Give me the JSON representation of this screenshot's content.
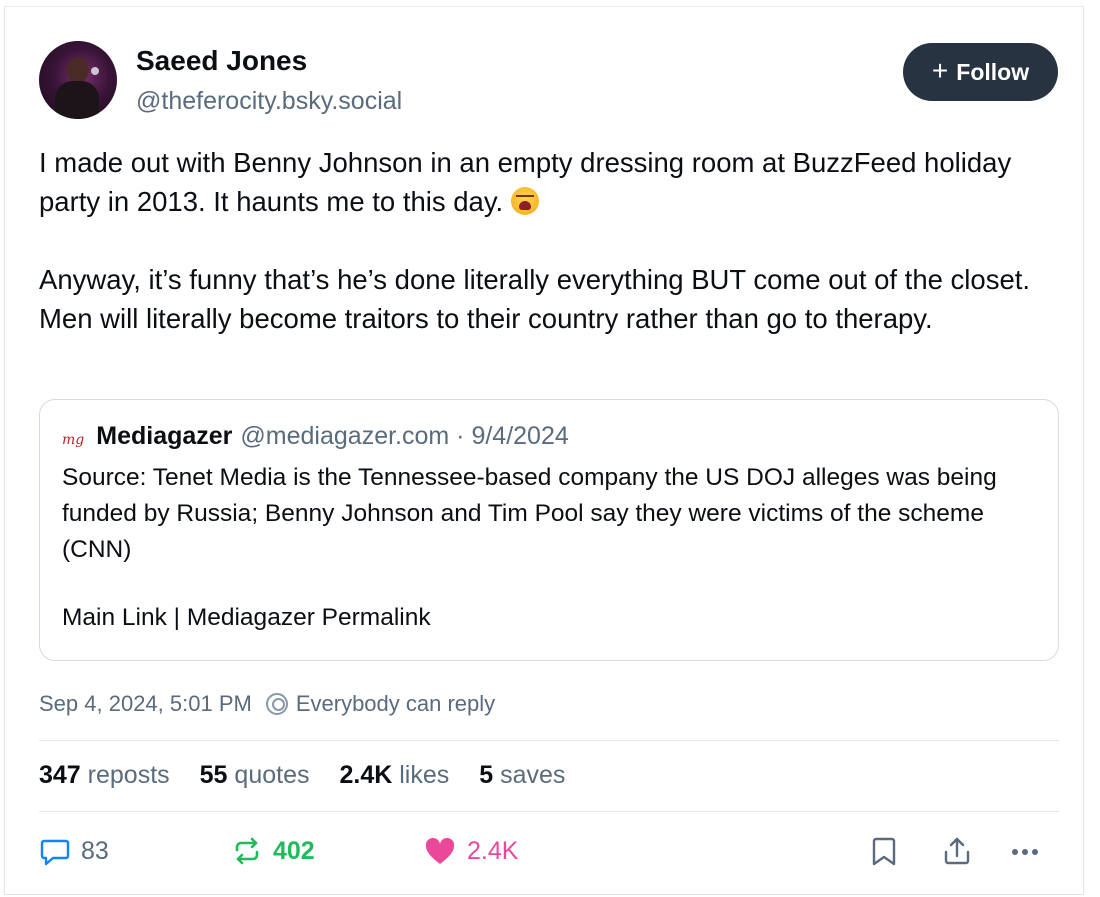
{
  "author": {
    "name": "Saeed Jones",
    "handle": "@theferocity.bsky.social"
  },
  "follow_button": {
    "plus": "+",
    "label": "Follow"
  },
  "post": {
    "paragraphs": [
      "I made out with Benny Johnson in an empty dressing room at BuzzFeed holiday party in 2013. It haunts me to this day.",
      "Anyway, it’s funny that’s he’s done literally everything BUT come out of the closet. Men will literally become traitors to their country rather than go to therapy."
    ],
    "emoji": "weary-face-emoji"
  },
  "quote": {
    "logo_text": "mg",
    "name": "Mediagazer",
    "meta": "@mediagazer.com · 9/4/2024",
    "body": "Source: Tenet Media is the Tennessee-based company the US DOJ alleges was being funded by Russia; Benny Johnson and Tim Pool say they were victims of the scheme (CNN)",
    "links": "Main Link | Mediagazer Permalink"
  },
  "timestamp": "Sep 4, 2024, 5:01 PM",
  "reply_setting": "Everybody can reply",
  "stats": [
    {
      "count": "347",
      "label": "reposts"
    },
    {
      "count": "55",
      "label": "quotes"
    },
    {
      "count": "2.4K",
      "label": "likes"
    },
    {
      "count": "5",
      "label": "saves"
    }
  ],
  "actions": {
    "reply_count": "83",
    "repost_count": "402",
    "like_count": "2.4K"
  },
  "colors": {
    "follow_bg": "#283341",
    "muted": "#5a6b7d",
    "repost_active": "#20bc5b",
    "like_active": "#ec4899",
    "reply_icon": "#1083fe"
  }
}
